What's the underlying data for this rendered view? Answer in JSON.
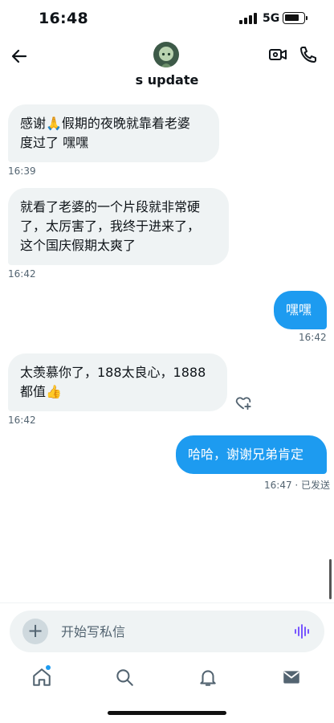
{
  "status_bar": {
    "time": "16:48",
    "network": "5G",
    "battery_level": 0.8
  },
  "header": {
    "title": "s update",
    "avatar_icon": "anime-avatar-icon",
    "back_icon": "back-arrow-icon",
    "video_icon": "video-camera-icon",
    "call_icon": "phone-icon"
  },
  "messages": [
    {
      "direction": "in",
      "text": "感谢🙏假期的夜晚就靠着老婆\n度过了 嘿嘿",
      "time": "16:39"
    },
    {
      "direction": "in",
      "text": "就看了老婆的一个片段就非常硬\n了，太厉害了，我终于进来了，\n这个国庆假期太爽了",
      "time": "16:42"
    },
    {
      "direction": "out",
      "text": "嘿嘿",
      "time": "16:42"
    },
    {
      "direction": "in",
      "text": "太羡慕你了，188太良心，1888\n都值👍",
      "time": "16:42"
    },
    {
      "direction": "out",
      "text": "哈哈，谢谢兄弟肯定",
      "time": "16:47 · 已发送"
    }
  ],
  "composer": {
    "placeholder": "开始写私信",
    "add_icon": "plus-icon",
    "voice_icon": "voice-wave-icon"
  },
  "tabbar": {
    "items": [
      "home-icon",
      "search-icon",
      "bell-icon",
      "mail-icon"
    ],
    "home_has_dot": true
  },
  "colors": {
    "accent": "#1d9bf0",
    "incoming_bubble": "#eff3f4",
    "secondary_text": "#536471",
    "voice_purple": "#7856ff"
  }
}
